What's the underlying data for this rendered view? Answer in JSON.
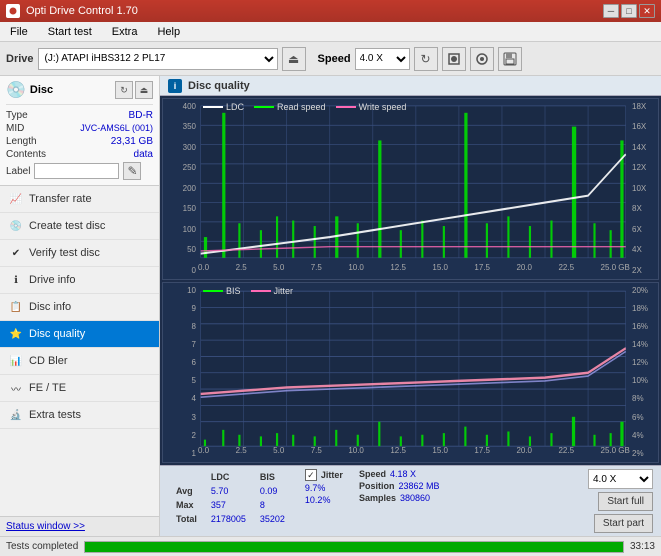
{
  "titlebar": {
    "title": "Opti Drive Control 1.70",
    "icon": "●",
    "minimize": "─",
    "maximize": "□",
    "close": "✕"
  },
  "menu": {
    "items": [
      "File",
      "Start test",
      "Extra",
      "Help"
    ]
  },
  "toolbar": {
    "drive_label": "Drive",
    "drive_value": "(J:) ATAPI iHBS312  2 PL17",
    "eject_icon": "⏏",
    "speed_label": "Speed",
    "speed_value": "4.0 X",
    "refresh_icon": "↻",
    "write_icon": "●",
    "read_icon": "◎",
    "save_icon": "💾"
  },
  "disc": {
    "title": "Disc",
    "type_label": "Type",
    "type_value": "BD-R",
    "mid_label": "MID",
    "mid_value": "JVC-AMS6L (001)",
    "length_label": "Length",
    "length_value": "23,31 GB",
    "contents_label": "Contents",
    "contents_value": "data",
    "label_label": "Label",
    "label_value": ""
  },
  "nav": {
    "items": [
      {
        "id": "transfer-rate",
        "label": "Transfer rate",
        "icon": "📈"
      },
      {
        "id": "create-test-disc",
        "label": "Create test disc",
        "icon": "💿"
      },
      {
        "id": "verify-test-disc",
        "label": "Verify test disc",
        "icon": "✔"
      },
      {
        "id": "drive-info",
        "label": "Drive info",
        "icon": "ℹ"
      },
      {
        "id": "disc-info",
        "label": "Disc info",
        "icon": "📋"
      },
      {
        "id": "disc-quality",
        "label": "Disc quality",
        "icon": "⭐",
        "active": true
      },
      {
        "id": "cd-bler",
        "label": "CD Bler",
        "icon": "📊"
      },
      {
        "id": "fe-te",
        "label": "FE / TE",
        "icon": "〰"
      },
      {
        "id": "extra-tests",
        "label": "Extra tests",
        "icon": "🔬"
      }
    ]
  },
  "status": {
    "window_link": "Status window >>",
    "progress": 100,
    "time": "33:13",
    "completed_text": "Tests completed"
  },
  "disc_quality": {
    "title": "Disc quality",
    "icon": "i"
  },
  "chart1": {
    "title": "LDC chart",
    "legend": [
      {
        "label": "LDC",
        "color": "#ffffff"
      },
      {
        "label": "Read speed",
        "color": "#00ff00"
      },
      {
        "label": "Write speed",
        "color": "#ff69b4"
      }
    ],
    "y_left": [
      "400",
      "350",
      "300",
      "250",
      "200",
      "150",
      "100",
      "50",
      "0"
    ],
    "y_right": [
      "18X",
      "16X",
      "14X",
      "12X",
      "10X",
      "8X",
      "6X",
      "4X",
      "2X"
    ],
    "x_labels": [
      "0.0",
      "2.5",
      "5.0",
      "7.5",
      "10.0",
      "12.5",
      "15.0",
      "17.5",
      "20.0",
      "22.5",
      "25.0 GB"
    ]
  },
  "chart2": {
    "title": "BIS chart",
    "legend": [
      {
        "label": "BIS",
        "color": "#00ff00"
      },
      {
        "label": "Jitter",
        "color": "#ff69b4"
      }
    ],
    "y_left": [
      "10",
      "9",
      "8",
      "7",
      "6",
      "5",
      "4",
      "3",
      "2",
      "1"
    ],
    "y_right": [
      "20%",
      "18%",
      "16%",
      "14%",
      "12%",
      "10%",
      "8%",
      "6%",
      "4%",
      "2%"
    ],
    "x_labels": [
      "0.0",
      "2.5",
      "5.0",
      "7.5",
      "10.0",
      "12.5",
      "15.0",
      "17.5",
      "20.0",
      "22.5",
      "25.0 GB"
    ]
  },
  "stats": {
    "col_ldc": "LDC",
    "col_bis": "BIS",
    "col_jitter": "Jitter",
    "row_avg": "Avg",
    "row_max": "Max",
    "row_total": "Total",
    "avg_ldc": "5.70",
    "avg_bis": "0.09",
    "avg_jitter": "9.7%",
    "max_ldc": "357",
    "max_bis": "8",
    "max_jitter": "10.2%",
    "total_ldc": "2178005",
    "total_bis": "35202",
    "jitter_checked": "✓",
    "speed_label": "Speed",
    "speed_value": "4.18 X",
    "position_label": "Position",
    "position_value": "23862 MB",
    "samples_label": "Samples",
    "samples_value": "380860",
    "speed_select": "4.0 X",
    "start_full_label": "Start full",
    "start_part_label": "Start part"
  }
}
